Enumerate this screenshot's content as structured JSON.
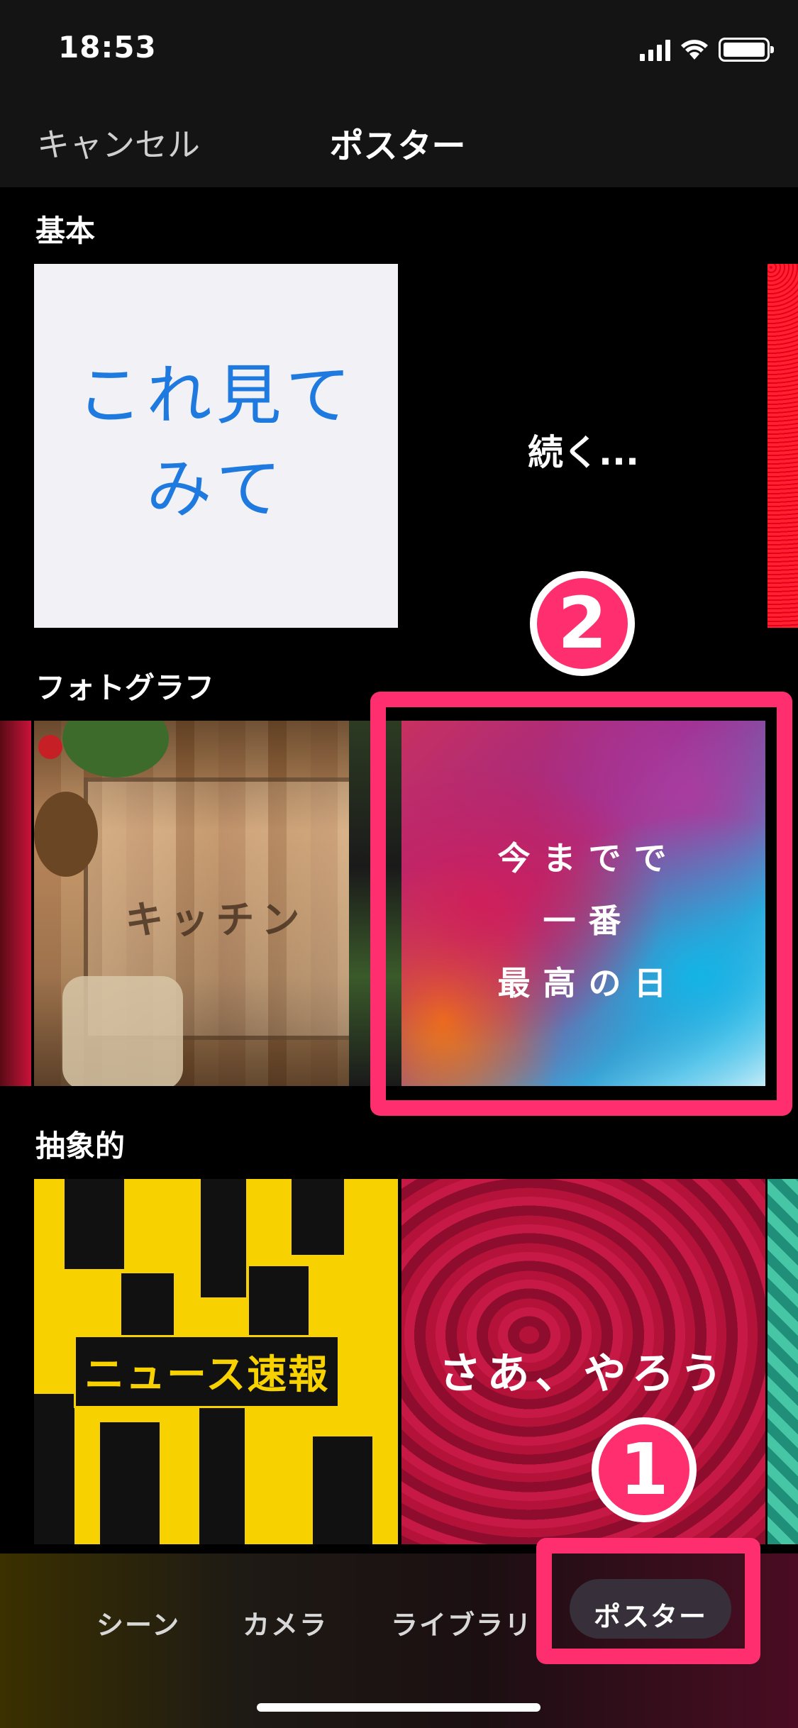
{
  "status_bar": {
    "time": "18:53",
    "icons": [
      "signal-icon",
      "wifi-icon",
      "battery-icon"
    ]
  },
  "header": {
    "cancel_label": "キャンセル",
    "title": "ポスター"
  },
  "sections": {
    "basic": {
      "label": "基本",
      "tiles": [
        {
          "text_line1": "これ見て",
          "text_line2": "みて"
        },
        {
          "text": "続く..."
        }
      ]
    },
    "photograph": {
      "label": "フォトグラフ",
      "tiles": [
        {
          "text": "キッチン"
        },
        {
          "text_line1": "今までで",
          "text_line2": "一番",
          "text_line3": "最高の日"
        }
      ]
    },
    "abstract": {
      "label": "抽象的",
      "tiles": [
        {
          "text": "ニュース速報"
        },
        {
          "text": "さあ、やろう"
        }
      ]
    }
  },
  "annotations": {
    "badge_1": "①",
    "badge_2": "②",
    "highlight_color": "#ff2e6e"
  },
  "tab_bar": {
    "tabs": [
      {
        "label": "シーン"
      },
      {
        "label": "カメラ"
      },
      {
        "label": "ライブラリ"
      },
      {
        "label": "ポスター",
        "selected": true
      }
    ]
  }
}
